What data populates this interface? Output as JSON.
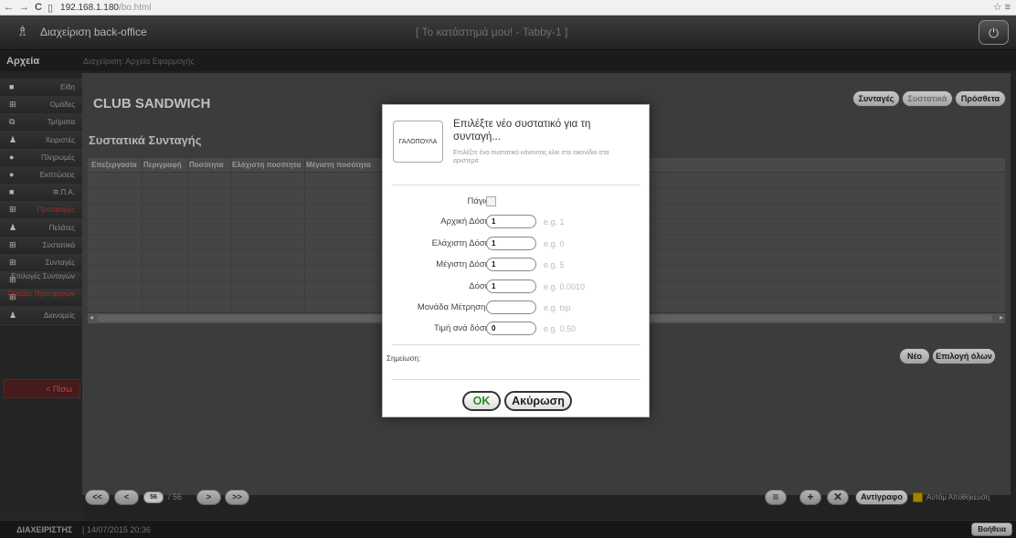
{
  "browser": {
    "back": "←",
    "forward": "→",
    "reload": "C",
    "page_icon": "▯",
    "url_host": "192.168.1.180",
    "url_path": "/bo.html",
    "star": "☆",
    "menu": "≡"
  },
  "header": {
    "title": "Διαχείριση back-office",
    "center": "[ Το κατάστημά μου!  -  Tabby-1 ]",
    "power_symbol": "⏻"
  },
  "subheader": {
    "section": "Αρχεία",
    "breadcrumb": "Διαχείριση: Αρχεία Εφαρμογής"
  },
  "sidebar": {
    "items": [
      {
        "label": "Είδη",
        "icon": "■",
        "icon_name": "items-icon",
        "color": "normal"
      },
      {
        "label": "Ομάδες",
        "icon": "⊞",
        "icon_name": "groups-icon",
        "color": "normal"
      },
      {
        "label": "Τμήματα",
        "icon": "⧉",
        "icon_name": "departments-icon",
        "color": "normal"
      },
      {
        "label": "Χειριστές",
        "icon": "♟",
        "icon_name": "operators-icon",
        "color": "normal"
      },
      {
        "label": "Πληρωμές",
        "icon": "●",
        "icon_name": "payments-icon",
        "color": "normal"
      },
      {
        "label": "Εκπτώσεις",
        "icon": "●",
        "icon_name": "discounts-icon",
        "color": "normal"
      },
      {
        "label": "Φ.Π.Α.",
        "icon": "■",
        "icon_name": "vat-icon",
        "color": "normal"
      },
      {
        "label": "Προσφορές",
        "icon": "⊞",
        "icon_name": "offers-icon",
        "color": "red"
      },
      {
        "label": "Πελάτες",
        "icon": "♟",
        "icon_name": "customers-icon",
        "color": "normal"
      },
      {
        "label": "Συστατικά",
        "icon": "⊞",
        "icon_name": "ingredients-icon",
        "color": "normal"
      },
      {
        "label": "Συνταγές",
        "icon": "⊞",
        "icon_name": "recipes-icon",
        "color": "normal"
      },
      {
        "label": "Επιλογές Συνταγών",
        "icon": "⊞",
        "icon_name": "recipe-options-icon",
        "color": "normal"
      },
      {
        "label": "Ομάδες Προσφορών",
        "icon": "⊞",
        "icon_name": "offer-groups-icon",
        "color": "red"
      },
      {
        "label": "Διανομείς",
        "icon": "♟",
        "icon_name": "distributors-icon",
        "color": "normal"
      }
    ],
    "back": "< Πίσω"
  },
  "main": {
    "recipe_name": "CLUB SANDWICH",
    "section_title": "Συστατικά Συνταγής",
    "top_buttons": {
      "recipes": "Συνταγές",
      "ingredients": "Συστατικά",
      "add": "Πρόσθετα"
    },
    "columns": [
      "Επεξεργασία",
      "Περιγραφή",
      "Ποσότητα",
      "Ελάχιστη ποσότητα",
      "Μέγιστη ποσότητα"
    ],
    "scroll_left": "◂",
    "scroll_right": "▸",
    "new_button": "Νέο",
    "select_all_button": "Επιλογή όλων"
  },
  "pager": {
    "first": "<<",
    "prev": "<",
    "current": "56",
    "total_text": "/ 56",
    "next": ">",
    "last": ">>",
    "list_icon": "≡",
    "add_icon": "+",
    "delete_icon": "✕",
    "copy_button": "Αντίγραφο",
    "autosave": "Αυτόμ Αποθήκευση"
  },
  "status": {
    "user": "ΔΙΑΧΕΙΡΙΣΤΗΣ",
    "datetime": "| 14/07/2015 20:36",
    "help": "Βοήθεια"
  },
  "modal": {
    "ingredient": "ΓΑΛΟΠΟΥΛΑ",
    "title": "Επιλέξτε νέο συστατικό για τη συνταγή...",
    "hint": "Επιλέξτε ένα συστατικό κάνοντας κλικ στο εικονίδιο στα αριστερά",
    "fixed_label": "Πάγιο",
    "fields": {
      "initial": {
        "label": "Αρχική Δόση",
        "value": "1",
        "example": "e.g. 1"
      },
      "min": {
        "label": "Ελάχιστη Δόση",
        "value": "1",
        "example": "e.g. 0"
      },
      "max": {
        "label": "Μέγιστη Δόση",
        "value": "1",
        "example": "e.g. 5"
      },
      "dose": {
        "label": "Δόση",
        "value": "1",
        "example": "e.g. 0.0010"
      },
      "unit": {
        "label": "Μονάδα Μέτρησης",
        "value": "",
        "example": "e.g. tsp"
      },
      "price": {
        "label": "Τιμή ανά δόση",
        "value": "0",
        "example": "e.g. 0.50"
      }
    },
    "notes_label": "Σημείωση:",
    "ok": "OK",
    "cancel": "Ακύρωση"
  },
  "colors": {
    "ok_green": "#2a8a2a",
    "sidebar_red": "#c43a2e",
    "autosave_yellow": "#c8a000"
  }
}
